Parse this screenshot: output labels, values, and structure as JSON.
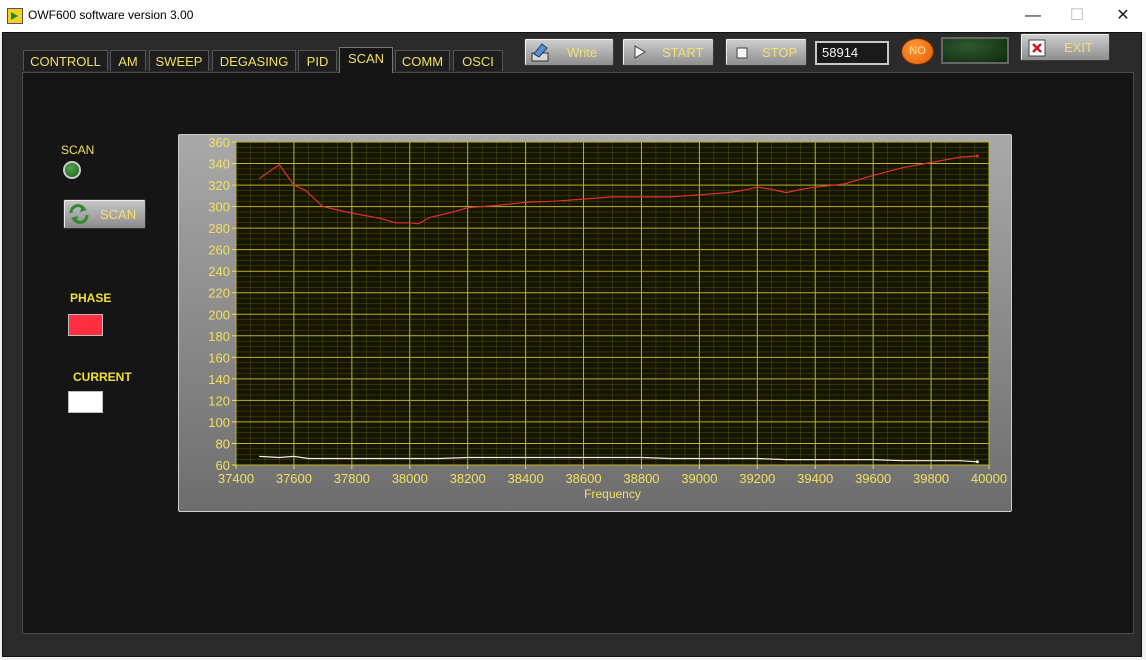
{
  "window": {
    "title": "OWF600 software version 3.00",
    "minimize_glyph": "—",
    "maximize_glyph": "☐",
    "close_glyph": "✕"
  },
  "tabs": [
    {
      "label": "CONTROLL",
      "active": false
    },
    {
      "label": "AM",
      "active": false
    },
    {
      "label": "SWEEP",
      "active": false
    },
    {
      "label": "DEGASING",
      "active": false
    },
    {
      "label": "PID",
      "active": false
    },
    {
      "label": "SCAN",
      "active": true
    },
    {
      "label": "COMM",
      "active": false
    },
    {
      "label": "OSCI",
      "active": false
    }
  ],
  "toolbar": {
    "write_label": "Write",
    "start_label": "START",
    "stop_label": "STOP",
    "counter_value": "58914",
    "status_led_label": "NO",
    "exit_label": "EXIT"
  },
  "scan_panel": {
    "scan_indicator_label": "SCAN",
    "scan_button_label": "SCAN",
    "phase_label": "PHASE",
    "current_label": "CURRENT",
    "phase_color": "#ff2f40",
    "current_color": "#ffffff"
  },
  "colors": {
    "accent_text": "#f0e060",
    "plot_background": "#151500",
    "grid": "#b5b52a"
  },
  "chart_data": {
    "type": "line",
    "xlabel": "Frequency",
    "xlim": [
      37400,
      40000
    ],
    "ylim": [
      60,
      360
    ],
    "x_ticks": [
      37400,
      37600,
      37800,
      38000,
      38200,
      38400,
      38600,
      38800,
      39000,
      39200,
      39400,
      39600,
      39800,
      40000
    ],
    "y_ticks": [
      60,
      80,
      100,
      120,
      140,
      160,
      180,
      200,
      220,
      240,
      260,
      280,
      300,
      320,
      340,
      360
    ],
    "grid": true,
    "series": [
      {
        "color": "#e03030",
        "points": [
          [
            37480,
            326
          ],
          [
            37550,
            339
          ],
          [
            37600,
            320
          ],
          [
            37640,
            315
          ],
          [
            37700,
            300
          ],
          [
            37800,
            294
          ],
          [
            37900,
            289
          ],
          [
            37950,
            285
          ],
          [
            38000,
            285
          ],
          [
            38030,
            284
          ],
          [
            38070,
            290
          ],
          [
            38150,
            295
          ],
          [
            38200,
            299
          ],
          [
            38300,
            301
          ],
          [
            38400,
            304
          ],
          [
            38500,
            305
          ],
          [
            38600,
            307
          ],
          [
            38700,
            309
          ],
          [
            38800,
            309
          ],
          [
            38900,
            309
          ],
          [
            39000,
            311
          ],
          [
            39100,
            313
          ],
          [
            39150,
            315
          ],
          [
            39200,
            318
          ],
          [
            39250,
            316
          ],
          [
            39300,
            313
          ],
          [
            39350,
            316
          ],
          [
            39400,
            318
          ],
          [
            39500,
            321
          ],
          [
            39600,
            329
          ],
          [
            39700,
            336
          ],
          [
            39800,
            341
          ],
          [
            39900,
            346
          ],
          [
            39960,
            347
          ]
        ]
      },
      {
        "color": "#f0f0f0",
        "points": [
          [
            37480,
            68
          ],
          [
            37550,
            67
          ],
          [
            37600,
            68
          ],
          [
            37650,
            66
          ],
          [
            37700,
            66
          ],
          [
            37800,
            66
          ],
          [
            37900,
            66
          ],
          [
            38000,
            66
          ],
          [
            38100,
            66
          ],
          [
            38200,
            67
          ],
          [
            38300,
            67
          ],
          [
            38400,
            67
          ],
          [
            38500,
            67
          ],
          [
            38600,
            67
          ],
          [
            38700,
            67
          ],
          [
            38800,
            67
          ],
          [
            38900,
            66
          ],
          [
            39000,
            66
          ],
          [
            39100,
            66
          ],
          [
            39200,
            66
          ],
          [
            39300,
            65
          ],
          [
            39400,
            65
          ],
          [
            39500,
            65
          ],
          [
            39600,
            65
          ],
          [
            39700,
            64
          ],
          [
            39800,
            64
          ],
          [
            39900,
            64
          ],
          [
            39960,
            63
          ]
        ]
      }
    ]
  }
}
